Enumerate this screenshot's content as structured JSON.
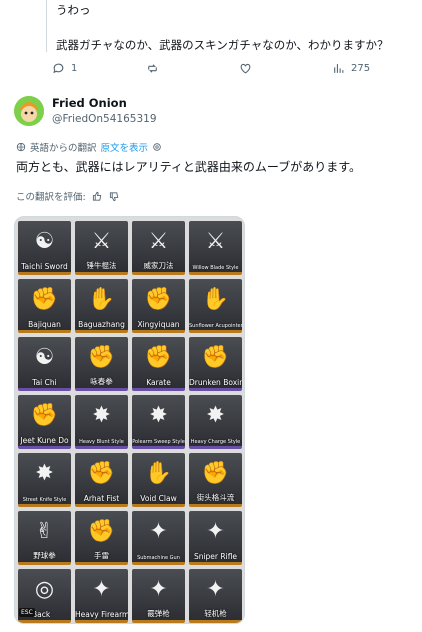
{
  "prev_tweet": {
    "line1": "うわっ",
    "line2": "武器ガチャなのか、武器のスキンガチャなのか、わかりますか？"
  },
  "actions": {
    "reply_count": "1",
    "views_count": "275"
  },
  "tweet": {
    "name": "Fried Onion",
    "handle": "@FriedOn54165319",
    "translated_from": "英語からの翻訳",
    "show_original": "原文を表示",
    "text": "両方とも、武器にはレアリティと武器由来のムーブがあります。",
    "rate_label": "この翻訳を評価:"
  },
  "colors": {
    "link": "#1d9bf0",
    "muted": "#536471",
    "gold_bar": "#b77a1d",
    "purple_bar": "#6a4fa8"
  },
  "tiles": [
    {
      "label": "Taichi Sword",
      "icon": "☯",
      "tiny": false,
      "bar": "gold"
    },
    {
      "label": "锤牛棍法",
      "icon": "⚔",
      "tiny": false,
      "bar": "gold"
    },
    {
      "label": "威家刀法",
      "icon": "⚔",
      "tiny": false,
      "bar": "gold"
    },
    {
      "label": "Willow Blade Style",
      "icon": "⚔",
      "tiny": true,
      "bar": "gold"
    },
    {
      "label": "Bajiquan",
      "icon": "✊",
      "tiny": false,
      "bar": "gold"
    },
    {
      "label": "Baguazhang",
      "icon": "✋",
      "tiny": false,
      "bar": "gold"
    },
    {
      "label": "Xingyiquan",
      "icon": "✊",
      "tiny": false,
      "bar": "gold"
    },
    {
      "label": "Sunflower Acupointer",
      "icon": "✋",
      "tiny": true,
      "bar": "gold"
    },
    {
      "label": "Tai Chi",
      "icon": "☯",
      "tiny": false,
      "bar": "purple"
    },
    {
      "label": "咏春拳",
      "icon": "✊",
      "tiny": false,
      "bar": "purple"
    },
    {
      "label": "Karate",
      "icon": "✊",
      "tiny": false,
      "bar": "purple"
    },
    {
      "label": "Drunken Boxing",
      "icon": "✊",
      "tiny": false,
      "bar": "purple"
    },
    {
      "label": "Jeet Kune Do",
      "icon": "✊",
      "tiny": false,
      "bar": "purple"
    },
    {
      "label": "Heavy Blunt Style",
      "icon": "✸",
      "tiny": true,
      "bar": "purple"
    },
    {
      "label": "Polearm Sweep Style",
      "icon": "✸",
      "tiny": true,
      "bar": "purple"
    },
    {
      "label": "Heavy Charge Style",
      "icon": "✸",
      "tiny": true,
      "bar": "purple"
    },
    {
      "label": "Street Knife Style",
      "icon": "✸",
      "tiny": true,
      "bar": "gold"
    },
    {
      "label": "Arhat Fist",
      "icon": "✊",
      "tiny": false,
      "bar": "gold"
    },
    {
      "label": "Void Claw",
      "icon": "✋",
      "tiny": false,
      "bar": "gold"
    },
    {
      "label": "街头格斗流",
      "icon": "✊",
      "tiny": false,
      "bar": "gold"
    },
    {
      "label": "野球拳",
      "icon": "✌",
      "tiny": false,
      "bar": "gold"
    },
    {
      "label": "手雷",
      "icon": "✊",
      "tiny": false,
      "bar": "gold"
    },
    {
      "label": "Submachine Gun",
      "icon": "✦",
      "tiny": true,
      "bar": "gold"
    },
    {
      "label": "Sniper Rifle",
      "icon": "✦",
      "tiny": false,
      "bar": "gold"
    },
    {
      "label": "Back",
      "icon": "◎",
      "tiny": false,
      "bar": "gold"
    },
    {
      "label": "Heavy Firearm",
      "icon": "✦",
      "tiny": false,
      "bar": "gold"
    },
    {
      "label": "霰弹枪",
      "icon": "✦",
      "tiny": false,
      "bar": "gold"
    },
    {
      "label": "轻机枪",
      "icon": "✦",
      "tiny": false,
      "bar": "gold"
    }
  ],
  "esc_label": "ESC"
}
